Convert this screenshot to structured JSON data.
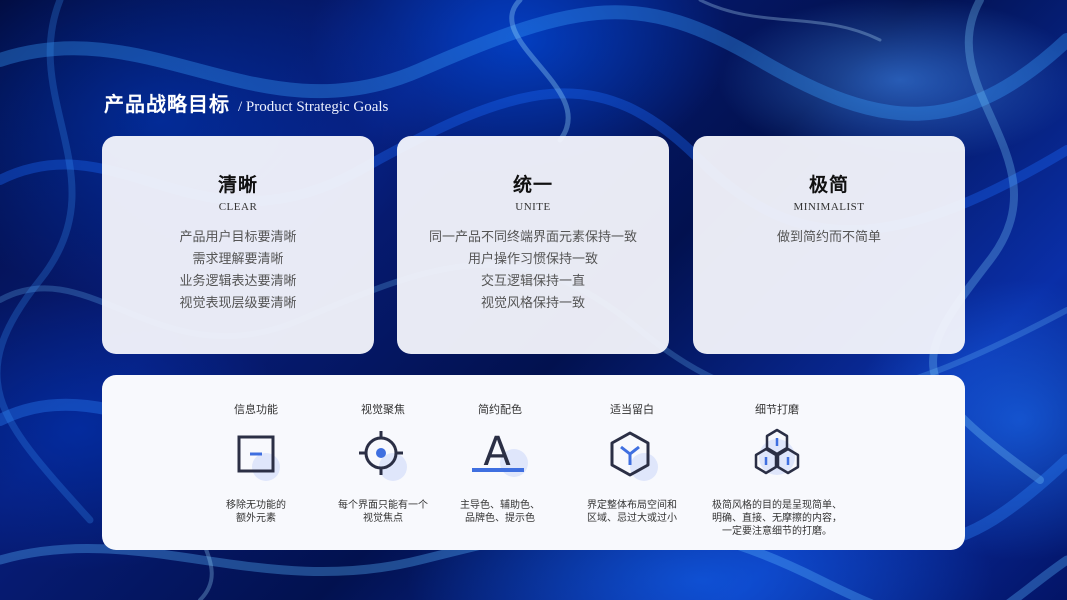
{
  "heading": {
    "title": "产品战略目标",
    "subtitle": "/ Product Strategic Goals"
  },
  "cards": [
    {
      "title": "清晰",
      "subtitle": "CLEAR",
      "lines": [
        "产品用户目标要清晰",
        "需求理解要清晰",
        "业务逻辑表达要清晰",
        "视觉表现层级要清晰"
      ]
    },
    {
      "title": "统一",
      "subtitle": "UNITE",
      "lines": [
        "同一产品不同终端界面元素保持一致",
        "用户操作习惯保持一致",
        "交互逻辑保持一直",
        "视觉风格保持一致"
      ]
    },
    {
      "title": "极简",
      "subtitle": "MINIMALIST",
      "lines": [
        "做到简约而不简单"
      ]
    }
  ],
  "features": [
    {
      "title": "信息功能",
      "icon": "square-minus-icon",
      "lines": [
        "移除无功能的",
        "额外元素"
      ]
    },
    {
      "title": "视觉聚焦",
      "icon": "crosshair-target-icon",
      "lines": [
        "每个界面只能有一个",
        "视觉焦点"
      ]
    },
    {
      "title": "简约配色",
      "icon": "letter-a-color-icon",
      "glyph": "A",
      "lines": [
        "主导色、辅助色、",
        "品牌色、提示色"
      ]
    },
    {
      "title": "适当留白",
      "icon": "cube-icon",
      "lines": [
        "界定整体布局空间和",
        "区域、忌过大或过小"
      ]
    },
    {
      "title": "细节打磨",
      "icon": "hexagon-cluster-icon",
      "lines": [
        "极简风格的目的是呈现简单、",
        "明确、直接、无摩擦的内容，",
        "一定要注意细节的打磨。"
      ]
    }
  ],
  "colors": {
    "accent": "#3f6fe0",
    "accent_light": "#dfe6fb",
    "icon_dark": "#2b2f45"
  }
}
